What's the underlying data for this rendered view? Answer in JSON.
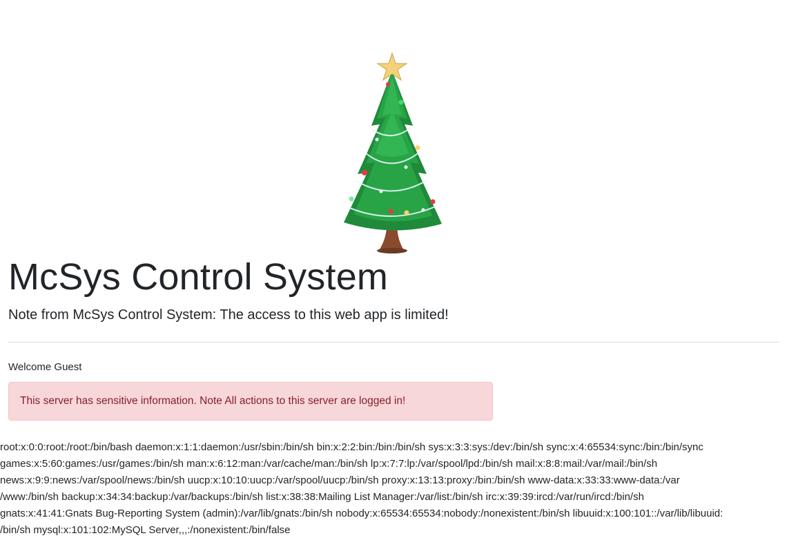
{
  "header": {
    "title": "McSys Control System",
    "note": "Note from McSys Control System: The access to this web app is limited!"
  },
  "welcome": "Welcome Guest",
  "alert": {
    "message": "This server has sensitive information. Note All actions to this server are logged in!",
    "colors": {
      "background": "#f8d7da",
      "border": "#f5c2c7",
      "text": "#842029"
    }
  },
  "passwd_lines": [
    "root:x:0:0:root:/root:/bin/bash daemon:x:1:1:daemon:/usr/sbin:/bin/sh bin:x:2:2:bin:/bin:/bin/sh sys:x:3:3:sys:/dev:/bin/sh sync:x:4:65534:sync:/bin:/bin/sync",
    "games:x:5:60:games:/usr/games:/bin/sh man:x:6:12:man:/var/cache/man:/bin/sh lp:x:7:7:lp:/var/spool/lpd:/bin/sh mail:x:8:8:mail:/var/mail:/bin/sh",
    "news:x:9:9:news:/var/spool/news:/bin/sh uucp:x:10:10:uucp:/var/spool/uucp:/bin/sh proxy:x:13:13:proxy:/bin:/bin/sh www-data:x:33:33:www-data:/var",
    "/www:/bin/sh backup:x:34:34:backup:/var/backups:/bin/sh list:x:38:38:Mailing List Manager:/var/list:/bin/sh irc:x:39:39:ircd:/var/run/ircd:/bin/sh",
    "gnats:x:41:41:Gnats Bug-Reporting System (admin):/var/lib/gnats:/bin/sh nobody:x:65534:65534:nobody:/nonexistent:/bin/sh libuuid:x:100:101::/var/lib/libuuid:",
    "/bin/sh mysql:x:101:102:MySQL Server,,,:/nonexistent:/bin/false"
  ],
  "images": {
    "tree": "christmas-tree-icon"
  }
}
